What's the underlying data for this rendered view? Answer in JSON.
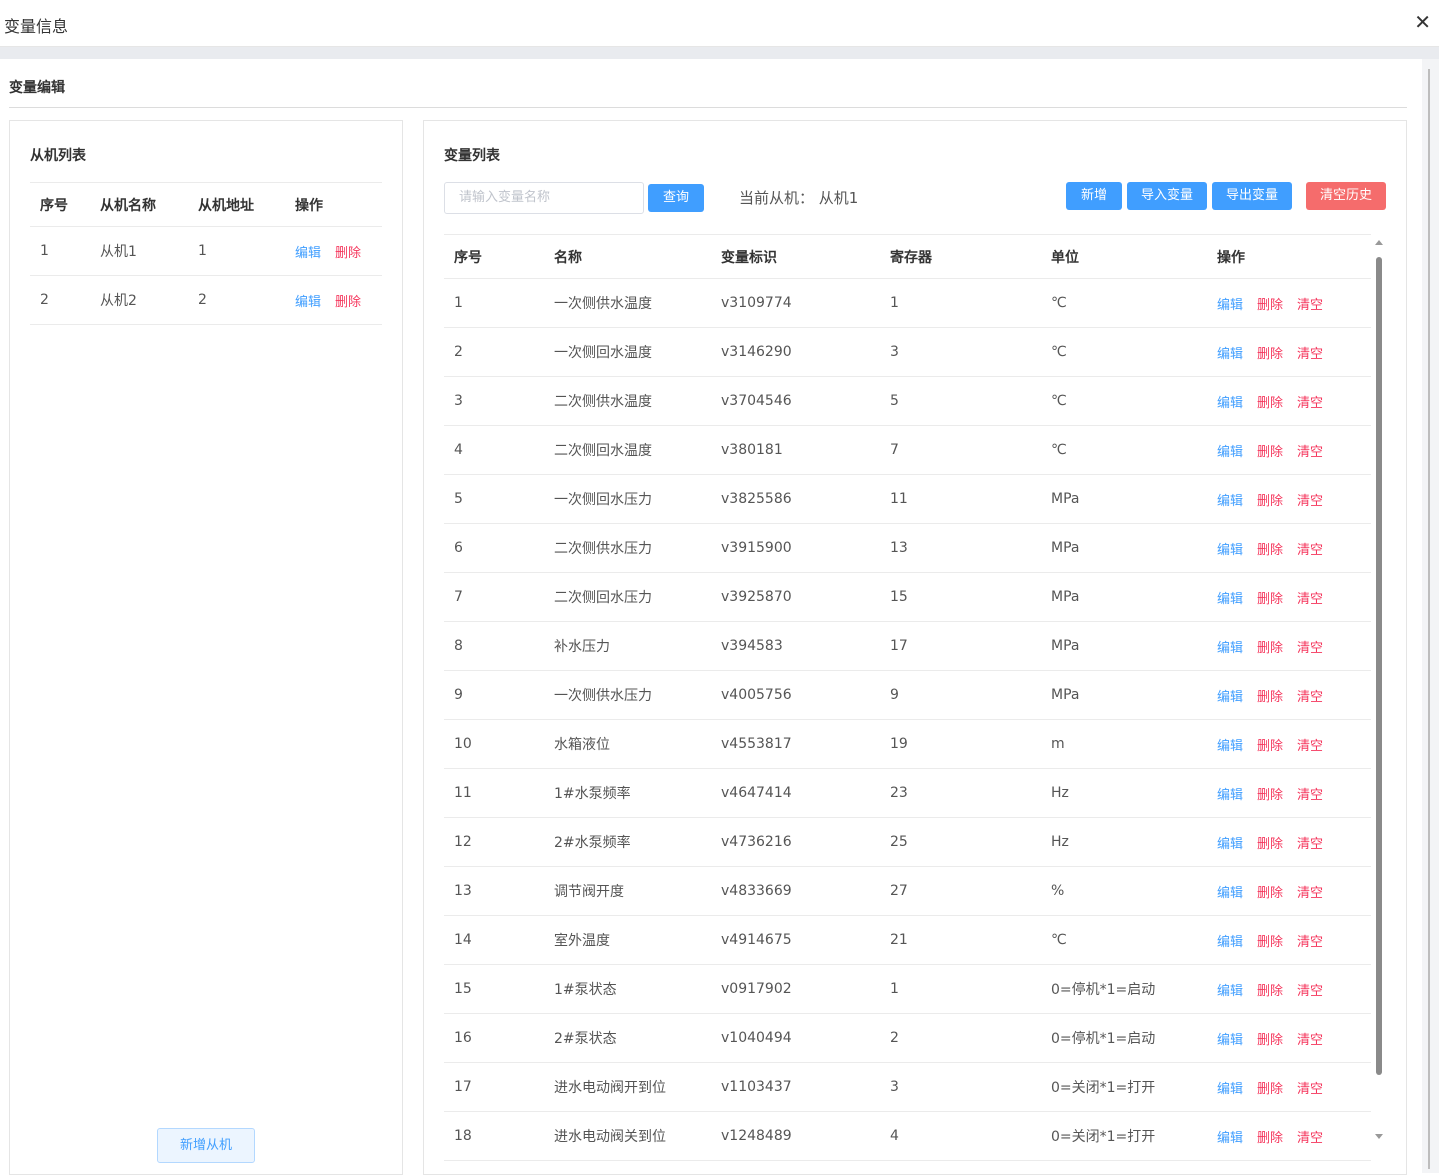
{
  "window": {
    "title": "变量信息",
    "close_glyph": "✕"
  },
  "section": {
    "title": "变量编辑"
  },
  "left": {
    "title": "从机列表",
    "columns": [
      "序号",
      "从机名称",
      "从机地址",
      "操作"
    ],
    "rows": [
      {
        "no": "1",
        "name": "从机1",
        "addr": "1"
      },
      {
        "no": "2",
        "name": "从机2",
        "addr": "2"
      }
    ],
    "edit_label": "编辑",
    "delete_label": "删除",
    "add_button": "新增从机"
  },
  "right": {
    "title": "变量列表",
    "search_placeholder": "请输入变量名称",
    "query_button": "查询",
    "current_label": "当前从机：",
    "current_value": "从机1",
    "buttons": {
      "add": "新增",
      "import": "导入变量",
      "export": "导出变量",
      "clear_history": "清空历史"
    },
    "columns": [
      "序号",
      "名称",
      "变量标识",
      "寄存器",
      "单位",
      "操作"
    ],
    "edit_label": "编辑",
    "delete_label": "删除",
    "clear_label": "清空",
    "rows": [
      {
        "no": "1",
        "name": "一次侧供水温度",
        "id": "v3109774",
        "reg": "1",
        "unit": "℃"
      },
      {
        "no": "2",
        "name": "一次侧回水温度",
        "id": "v3146290",
        "reg": "3",
        "unit": "℃"
      },
      {
        "no": "3",
        "name": "二次侧供水温度",
        "id": "v3704546",
        "reg": "5",
        "unit": "℃"
      },
      {
        "no": "4",
        "name": "二次侧回水温度",
        "id": "v380181",
        "reg": "7",
        "unit": "℃"
      },
      {
        "no": "5",
        "name": "一次侧回水压力",
        "id": "v3825586",
        "reg": "11",
        "unit": "MPa"
      },
      {
        "no": "6",
        "name": "二次侧供水压力",
        "id": "v3915900",
        "reg": "13",
        "unit": "MPa"
      },
      {
        "no": "7",
        "name": "二次侧回水压力",
        "id": "v3925870",
        "reg": "15",
        "unit": "MPa"
      },
      {
        "no": "8",
        "name": "补水压力",
        "id": "v394583",
        "reg": "17",
        "unit": "MPa"
      },
      {
        "no": "9",
        "name": "一次侧供水压力",
        "id": "v4005756",
        "reg": "9",
        "unit": "MPa"
      },
      {
        "no": "10",
        "name": "水箱液位",
        "id": "v4553817",
        "reg": "19",
        "unit": "m"
      },
      {
        "no": "11",
        "name": "1#水泵频率",
        "id": "v4647414",
        "reg": "23",
        "unit": "Hz"
      },
      {
        "no": "12",
        "name": "2#水泵频率",
        "id": "v4736216",
        "reg": "25",
        "unit": "Hz"
      },
      {
        "no": "13",
        "name": "调节阀开度",
        "id": "v4833669",
        "reg": "27",
        "unit": "%"
      },
      {
        "no": "14",
        "name": "室外温度",
        "id": "v4914675",
        "reg": "21",
        "unit": "℃"
      },
      {
        "no": "15",
        "name": "1#泵状态",
        "id": "v0917902",
        "reg": "1",
        "unit": "0=停机*1=启动"
      },
      {
        "no": "16",
        "name": "2#泵状态",
        "id": "v1040494",
        "reg": "2",
        "unit": "0=停机*1=启动"
      },
      {
        "no": "17",
        "name": "进水电动阀开到位",
        "id": "v1103437",
        "reg": "3",
        "unit": "0=关闭*1=打开"
      },
      {
        "no": "18",
        "name": "进水电动阀关到位",
        "id": "v1248489",
        "reg": "4",
        "unit": "0=关闭*1=打开"
      }
    ]
  },
  "colors": {
    "accent": "#409eff",
    "danger": "#f5365c",
    "clear_button": "#f56c6c"
  }
}
